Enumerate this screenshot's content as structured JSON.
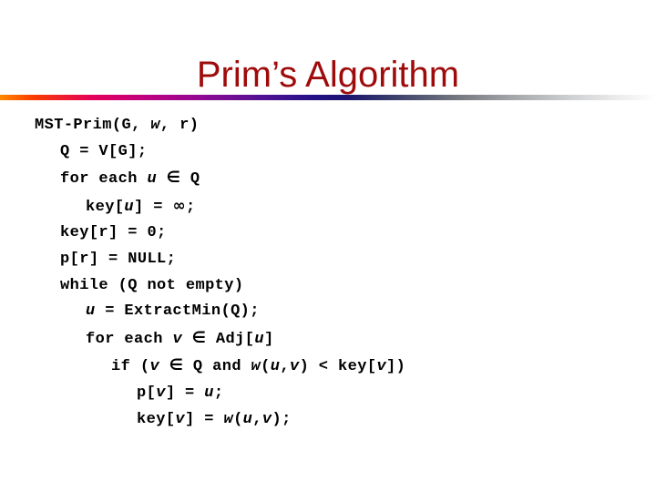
{
  "slide": {
    "title": "Prim’s Algorithm",
    "title_color": "#9e0b0b",
    "background_color": "#ffffff",
    "divider": {
      "name": "gradient-rule",
      "colors": [
        "#ff8a00",
        "#fa3c00",
        "#e5005a",
        "#c0007f",
        "#8e0a93",
        "#4b1293",
        "#241184",
        "#1b1470",
        "#3b3f6b",
        "#76797f",
        "#a9abaf",
        "#cfd0d2",
        "#ebebec",
        "#ffffff"
      ]
    }
  },
  "code": {
    "language": "pseudocode",
    "text_color": "#000000",
    "lines": [
      {
        "indent": 0,
        "text": "MST-Prim(G, w, r)"
      },
      {
        "indent": 1,
        "text": "Q = V[G];"
      },
      {
        "indent": 1,
        "text": "for each u ∈ Q"
      },
      {
        "indent": 2,
        "text": "key[u] = ∞;"
      },
      {
        "indent": 1,
        "text": "key[r] = 0;"
      },
      {
        "indent": 1,
        "text": "p[r] = NULL;"
      },
      {
        "indent": 1,
        "text": "while (Q not empty)"
      },
      {
        "indent": 2,
        "text": "u = ExtractMin(Q);"
      },
      {
        "indent": 2,
        "text": "for each v ∈ Adj[u]"
      },
      {
        "indent": 3,
        "text": "if (v ∈ Q and w(u,v) < key[v])"
      },
      {
        "indent": 4,
        "text": "p[v] = u;"
      },
      {
        "indent": 4,
        "text": "key[v] = w(u,v);"
      }
    ]
  }
}
